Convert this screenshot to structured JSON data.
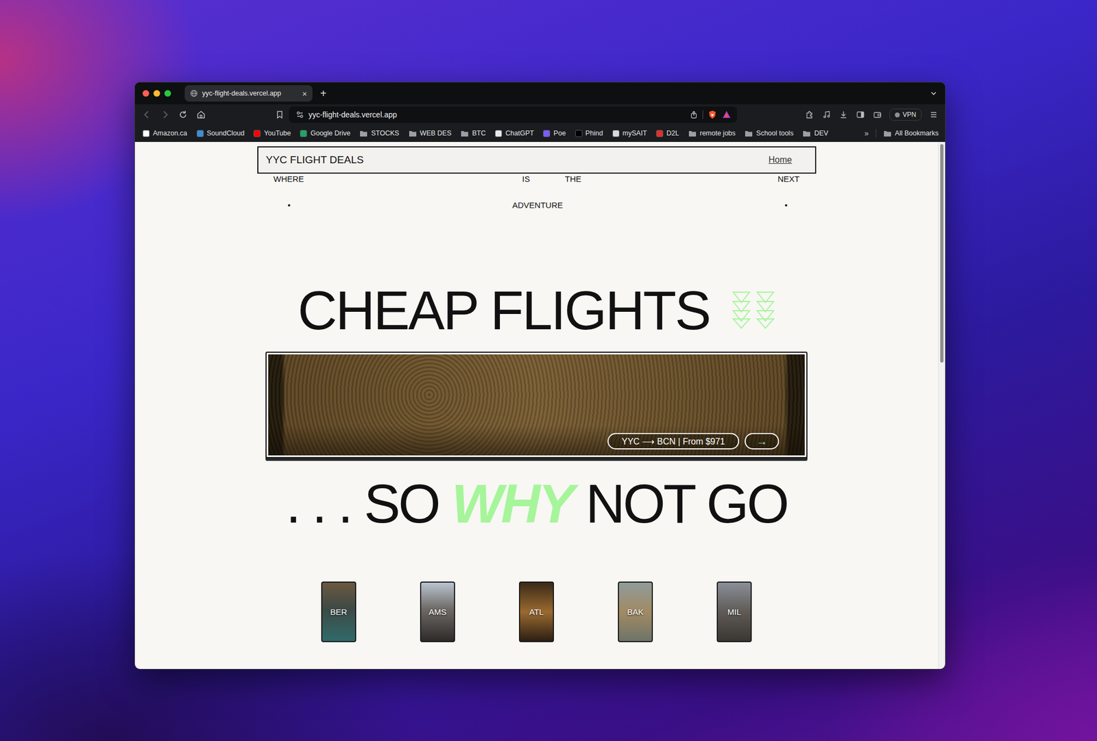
{
  "tabs": [
    {
      "label": "yyc-flight-deals.vercel.app",
      "selected": true,
      "close": "×"
    }
  ],
  "new_tab": "+",
  "address_bar": {
    "url": "yyc-flight-deals.vercel.app"
  },
  "vpn": "VPN",
  "bookmarks": [
    {
      "label": "Amazon.ca",
      "kind": "site",
      "color": "#ffffff"
    },
    {
      "label": "SoundCloud",
      "kind": "site",
      "color": "#3b8fd9"
    },
    {
      "label": "YouTube",
      "kind": "site",
      "color": "#ff0000"
    },
    {
      "label": "Google Drive",
      "kind": "site",
      "color": "#1fa463"
    },
    {
      "label": "STOCKS",
      "kind": "folder"
    },
    {
      "label": "WEB DES",
      "kind": "folder"
    },
    {
      "label": "BTC",
      "kind": "folder"
    },
    {
      "label": "ChatGPT",
      "kind": "site",
      "color": "#e8e8e8"
    },
    {
      "label": "Poe",
      "kind": "site",
      "color": "#7b5cff"
    },
    {
      "label": "Phind",
      "kind": "site",
      "color": "#000000"
    },
    {
      "label": "mySAIT",
      "kind": "site",
      "color": "#d9d9d9"
    },
    {
      "label": "D2L",
      "kind": "site",
      "color": "#e0312a"
    },
    {
      "label": "remote jobs",
      "kind": "folder"
    },
    {
      "label": "School tools",
      "kind": "folder"
    },
    {
      "label": "DEV",
      "kind": "folder"
    }
  ],
  "bookmarks_overflow": "»",
  "all_bookmarks": "All Bookmarks",
  "page": {
    "brand": "YYC FLIGHT DEALS",
    "nav": [
      {
        "label": "Home"
      }
    ],
    "tagline_top": [
      "WHERE",
      "IS",
      "THE",
      "NEXT"
    ],
    "tagline_bottom": [
      "•",
      "ADVENTURE",
      "•"
    ],
    "headline": "CHEAP FLIGHTS",
    "featured": {
      "route": "YYC ⟶ BCN | From $971",
      "arrow": "→"
    },
    "subhead": {
      "lead": ". . .",
      "before": "SO",
      "accent": "WHY",
      "after": "NOT GO"
    },
    "destinations": [
      {
        "code": "BER"
      },
      {
        "code": "AMS"
      },
      {
        "code": "ATL"
      },
      {
        "code": "BAK"
      },
      {
        "code": "MIL"
      }
    ]
  }
}
